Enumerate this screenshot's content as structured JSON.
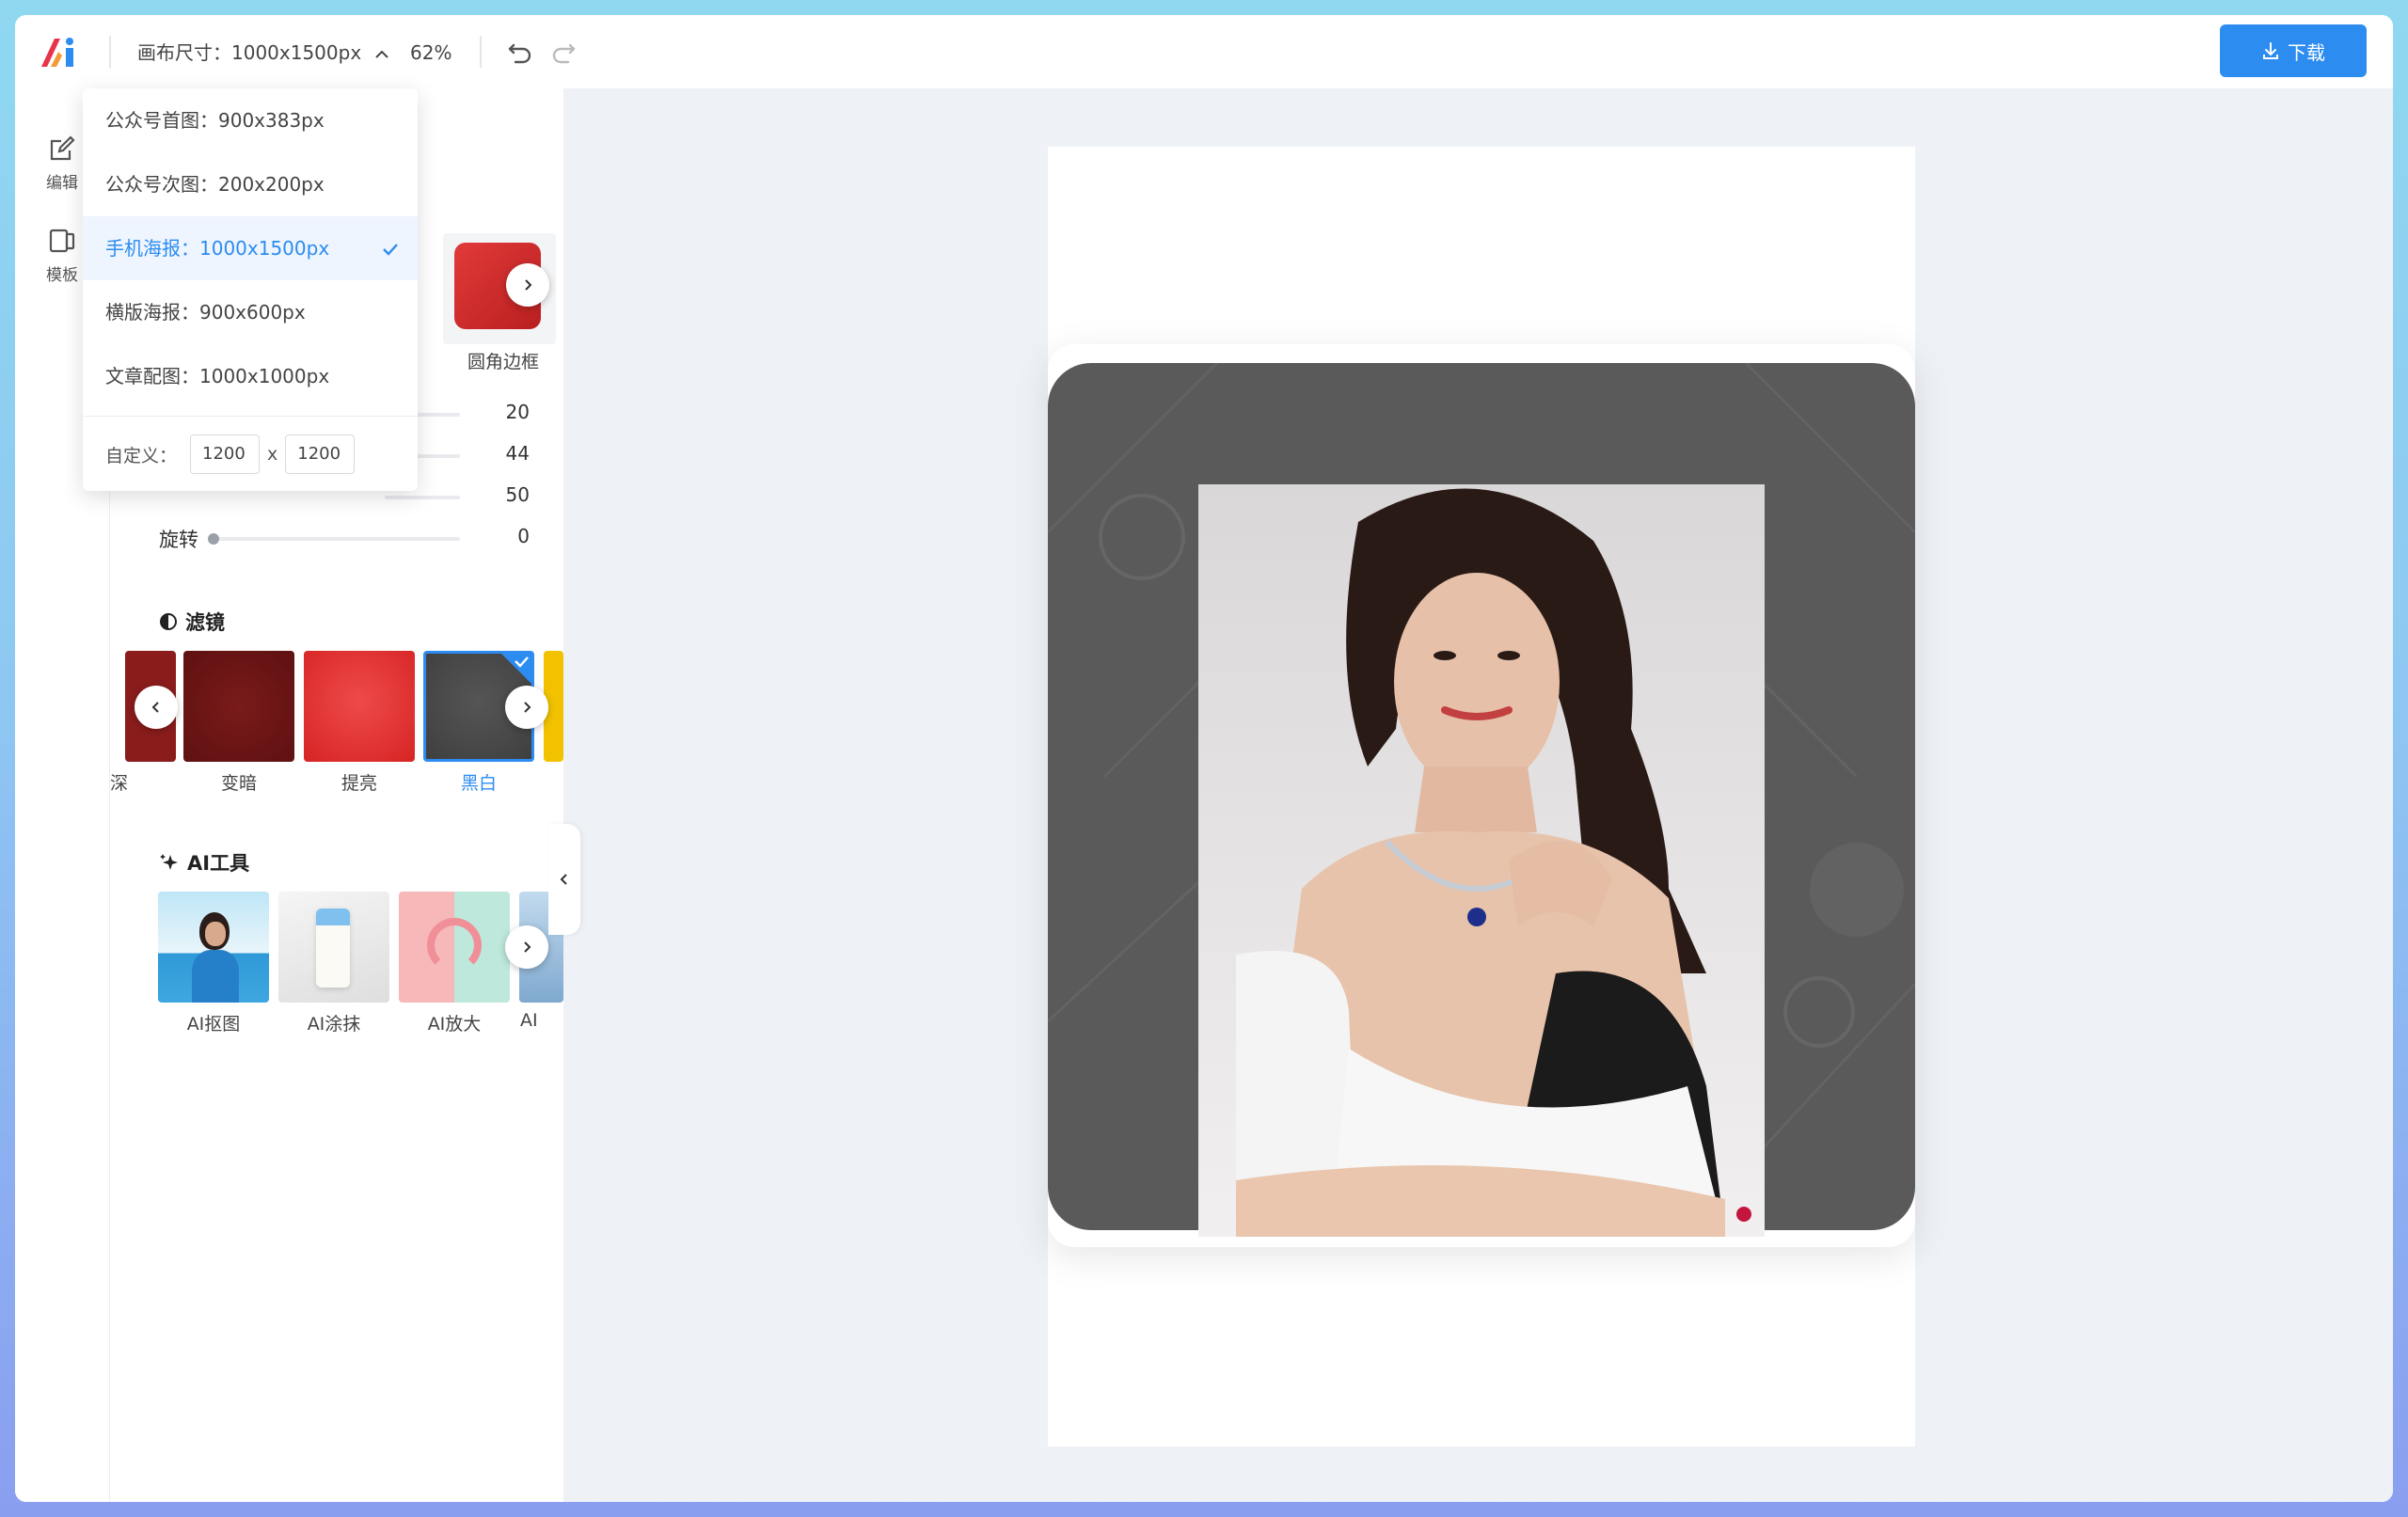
{
  "toolbar": {
    "canvas_size_label": "画布尺寸：1000x1500px",
    "zoom": "62%",
    "download_label": "下载"
  },
  "rail": {
    "items": [
      {
        "label": "编辑",
        "icon": "edit-icon"
      },
      {
        "label": "模板",
        "icon": "template-icon"
      }
    ]
  },
  "size_dropdown": {
    "options": [
      {
        "label": "公众号首图：900x383px",
        "selected": false
      },
      {
        "label": "公众号次图：200x200px",
        "selected": false
      },
      {
        "label": "手机海报：1000x1500px",
        "selected": true
      },
      {
        "label": "横版海报：900x600px",
        "selected": false
      },
      {
        "label": "文章配图：1000x1000px",
        "selected": false
      }
    ],
    "custom_label": "自定义：",
    "custom_width": "1200",
    "custom_sep": "x",
    "custom_height": "1200"
  },
  "frames": {
    "visible_label": "圆角边框"
  },
  "sliders": [
    {
      "label": "",
      "value": "20"
    },
    {
      "label": "",
      "value": "44"
    },
    {
      "label": "",
      "value": "50"
    },
    {
      "label": "旋转",
      "value": "0"
    }
  ],
  "filters": {
    "title": "滤镜",
    "items": [
      {
        "label": "深",
        "color": "#8a1c1c"
      },
      {
        "label": "变暗",
        "color": "#6e1515"
      },
      {
        "label": "提亮",
        "color": "#e03232"
      },
      {
        "label": "黑白",
        "color": "#4a4a4a",
        "selected": true
      }
    ]
  },
  "ai_tools": {
    "title": "AI工具",
    "items": [
      {
        "label": "AI抠图"
      },
      {
        "label": "AI涂抹"
      },
      {
        "label": "AI放大"
      },
      {
        "label": "AI"
      }
    ]
  },
  "colors": {
    "accent": "#2d8cf0",
    "frame_gray": "#5a5a5a",
    "workspace_bg": "#eef1f6"
  }
}
